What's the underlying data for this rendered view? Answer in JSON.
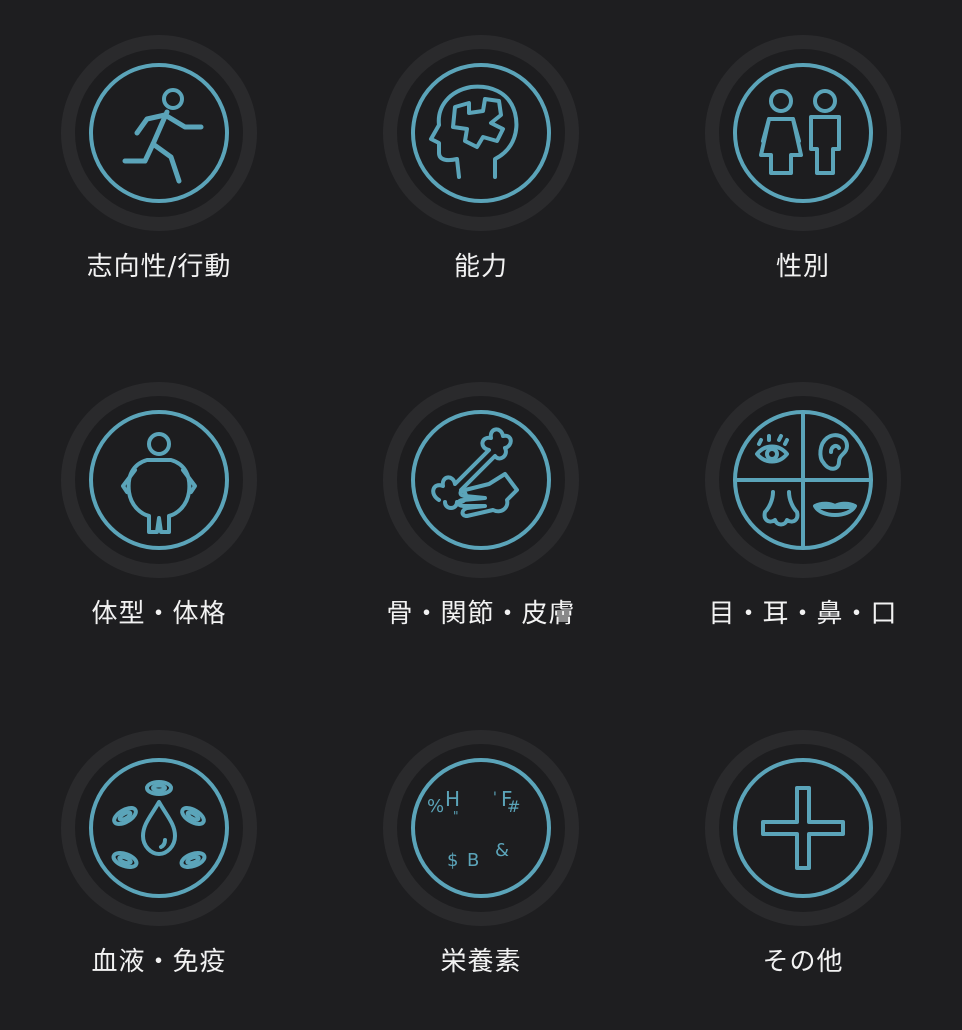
{
  "categories": [
    {
      "label": "志向性/行動",
      "icon": "running-person-icon"
    },
    {
      "label": "能力",
      "icon": "brain-head-icon"
    },
    {
      "label": "性別",
      "icon": "male-female-icon"
    },
    {
      "label": "体型・体格",
      "icon": "body-shape-icon"
    },
    {
      "label": "骨・関節・皮膚",
      "icon": "bone-hand-icon"
    },
    {
      "label": "目・耳・鼻・口",
      "icon": "eye-ear-nose-mouth-icon"
    },
    {
      "label": "血液・免疫",
      "icon": "blood-drop-icon"
    },
    {
      "label": "栄養素",
      "icon": "nutrient-symbols-icon"
    },
    {
      "label": "その他",
      "icon": "plus-icon"
    }
  ],
  "nutrient_glyphs": [
    "%",
    "H",
    "\"",
    "'",
    "F",
    "#",
    "$",
    "B",
    "&"
  ],
  "colors": {
    "background": "#1e1e20",
    "accent": "#5ba4b9",
    "label": "#f2f2f2"
  }
}
